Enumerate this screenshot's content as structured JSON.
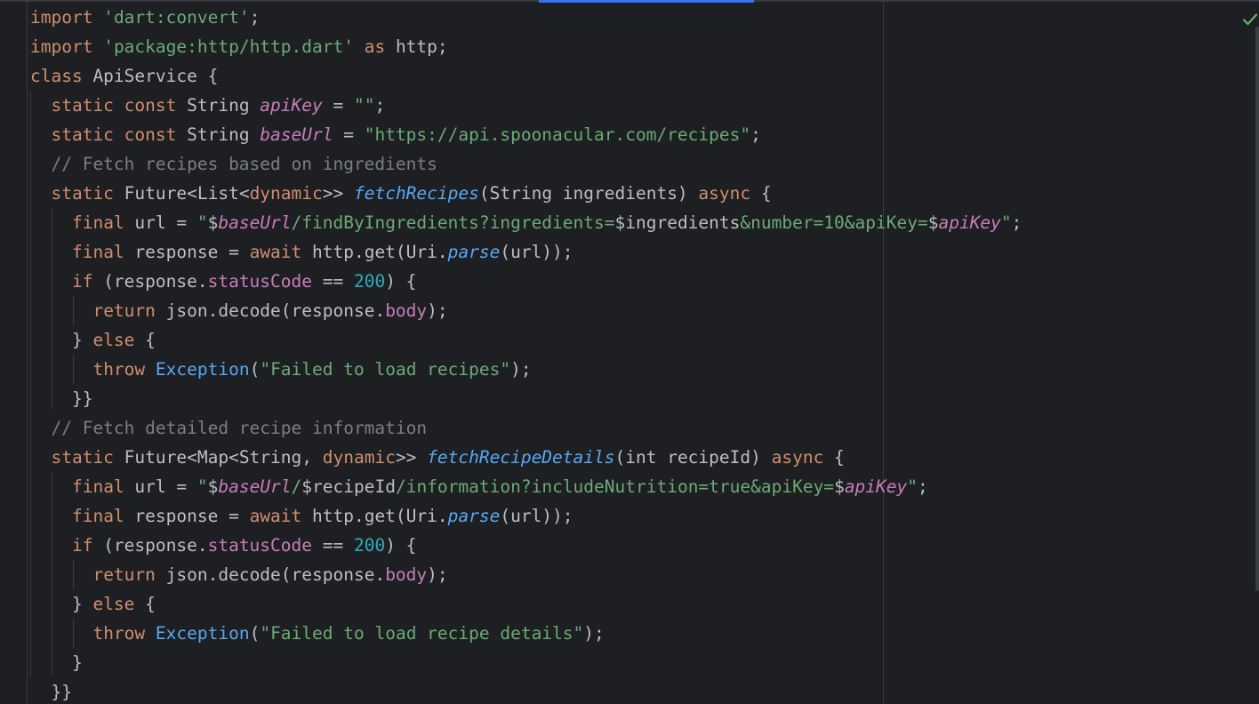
{
  "editor": {
    "language": "dart",
    "status_icon": "check-icon",
    "colors": {
      "background": "#1e1f22",
      "keyword": "#cf8e6d",
      "string": "#6aab73",
      "function": "#56a8f5",
      "field": "#c77dbb",
      "number": "#2aacb8",
      "comment": "#7a7e85",
      "text": "#bcbec4",
      "accent": "#3574f0"
    },
    "lines": [
      [
        [
          "kw",
          "import"
        ],
        [
          "t",
          " "
        ],
        [
          "str",
          "'dart:convert'"
        ],
        [
          "t",
          ";"
        ]
      ],
      [
        [
          "kw",
          "import"
        ],
        [
          "t",
          " "
        ],
        [
          "str",
          "'package:http/http.dart'"
        ],
        [
          "t",
          " "
        ],
        [
          "kw",
          "as"
        ],
        [
          "t",
          " http;"
        ]
      ],
      [
        [
          "kw",
          "class"
        ],
        [
          "t",
          " ApiService {"
        ]
      ],
      [
        [
          "t",
          "  "
        ],
        [
          "kw",
          "static const"
        ],
        [
          "t",
          " String "
        ],
        [
          "field",
          "apiKey"
        ],
        [
          "t",
          " = "
        ],
        [
          "str",
          "\"\""
        ],
        [
          "t",
          ";"
        ]
      ],
      [
        [
          "t",
          "  "
        ],
        [
          "kw",
          "static const"
        ],
        [
          "t",
          " String "
        ],
        [
          "field",
          "baseUrl"
        ],
        [
          "t",
          " = "
        ],
        [
          "str",
          "\"https://api.spoonacular.com/recipes\""
        ],
        [
          "t",
          ";"
        ]
      ],
      [
        [
          "t",
          "  "
        ],
        [
          "cmt",
          "// Fetch recipes based on ingredients"
        ]
      ],
      [
        [
          "t",
          "  "
        ],
        [
          "kw",
          "static"
        ],
        [
          "t",
          " Future<List<"
        ],
        [
          "kw",
          "dynamic"
        ],
        [
          "t",
          ">> "
        ],
        [
          "fn",
          "fetchRecipes"
        ],
        [
          "t",
          "(String ingredients) "
        ],
        [
          "kw",
          "async"
        ],
        [
          "t",
          " {"
        ]
      ],
      [
        [
          "t",
          "    "
        ],
        [
          "kw",
          "final"
        ],
        [
          "t",
          " url = "
        ],
        [
          "str",
          "\""
        ],
        [
          "t",
          "$"
        ],
        [
          "field",
          "baseUrl"
        ],
        [
          "str",
          "/findByIngredients?ingredients="
        ],
        [
          "t",
          "$ingredients"
        ],
        [
          "str",
          "&number=10&apiKey="
        ],
        [
          "t",
          "$"
        ],
        [
          "field",
          "apiKey"
        ],
        [
          "str",
          "\""
        ],
        [
          "t",
          ";"
        ]
      ],
      [
        [
          "t",
          "    "
        ],
        [
          "kw",
          "final"
        ],
        [
          "t",
          " response = "
        ],
        [
          "kw",
          "await"
        ],
        [
          "t",
          " http.get(Uri."
        ],
        [
          "fn",
          "parse"
        ],
        [
          "t",
          "(url));"
        ]
      ],
      [
        [
          "t",
          "    "
        ],
        [
          "kw",
          "if"
        ],
        [
          "t",
          " (response."
        ],
        [
          "prop",
          "statusCode"
        ],
        [
          "t",
          " == "
        ],
        [
          "num",
          "200"
        ],
        [
          "t",
          ") {"
        ]
      ],
      [
        [
          "t",
          "      "
        ],
        [
          "kw",
          "return"
        ],
        [
          "t",
          " json.decode(response."
        ],
        [
          "prop",
          "body"
        ],
        [
          "t",
          ");"
        ]
      ],
      [
        [
          "t",
          "    } "
        ],
        [
          "kw",
          "else"
        ],
        [
          "t",
          " {"
        ]
      ],
      [
        [
          "t",
          "      "
        ],
        [
          "kw",
          "throw"
        ],
        [
          "t",
          " "
        ],
        [
          "cls",
          "Exception"
        ],
        [
          "t",
          "("
        ],
        [
          "str",
          "\"Failed to load recipes\""
        ],
        [
          "t",
          ");"
        ]
      ],
      [
        [
          "t",
          "    }}"
        ]
      ],
      [
        [
          "t",
          "  "
        ],
        [
          "cmt",
          "// Fetch detailed recipe information"
        ]
      ],
      [
        [
          "t",
          "  "
        ],
        [
          "kw",
          "static"
        ],
        [
          "t",
          " Future<Map<String, "
        ],
        [
          "kw",
          "dynamic"
        ],
        [
          "t",
          ">> "
        ],
        [
          "fn",
          "fetchRecipeDetails"
        ],
        [
          "t",
          "(int recipeId) "
        ],
        [
          "kw",
          "async"
        ],
        [
          "t",
          " {"
        ]
      ],
      [
        [
          "t",
          "    "
        ],
        [
          "kw",
          "final"
        ],
        [
          "t",
          " url = "
        ],
        [
          "str",
          "\""
        ],
        [
          "t",
          "$"
        ],
        [
          "field",
          "baseUrl"
        ],
        [
          "str",
          "/"
        ],
        [
          "t",
          "$recipeId"
        ],
        [
          "str",
          "/information?includeNutrition=true&apiKey="
        ],
        [
          "t",
          "$"
        ],
        [
          "field",
          "apiKey"
        ],
        [
          "str",
          "\""
        ],
        [
          "t",
          ";"
        ]
      ],
      [
        [
          "t",
          "    "
        ],
        [
          "kw",
          "final"
        ],
        [
          "t",
          " response = "
        ],
        [
          "kw",
          "await"
        ],
        [
          "t",
          " http.get(Uri."
        ],
        [
          "fn",
          "parse"
        ],
        [
          "t",
          "(url));"
        ]
      ],
      [
        [
          "t",
          "    "
        ],
        [
          "kw",
          "if"
        ],
        [
          "t",
          " (response."
        ],
        [
          "prop",
          "statusCode"
        ],
        [
          "t",
          " == "
        ],
        [
          "num",
          "200"
        ],
        [
          "t",
          ") {"
        ]
      ],
      [
        [
          "t",
          "      "
        ],
        [
          "kw",
          "return"
        ],
        [
          "t",
          " json.decode(response."
        ],
        [
          "prop",
          "body"
        ],
        [
          "t",
          ");"
        ]
      ],
      [
        [
          "t",
          "    } "
        ],
        [
          "kw",
          "else"
        ],
        [
          "t",
          " {"
        ]
      ],
      [
        [
          "t",
          "      "
        ],
        [
          "kw",
          "throw"
        ],
        [
          "t",
          " "
        ],
        [
          "cls",
          "Exception"
        ],
        [
          "t",
          "("
        ],
        [
          "str",
          "\"Failed to load recipe details\""
        ],
        [
          "t",
          ");"
        ]
      ],
      [
        [
          "t",
          "    }"
        ]
      ],
      [
        [
          "t",
          "  }}"
        ]
      ]
    ]
  }
}
